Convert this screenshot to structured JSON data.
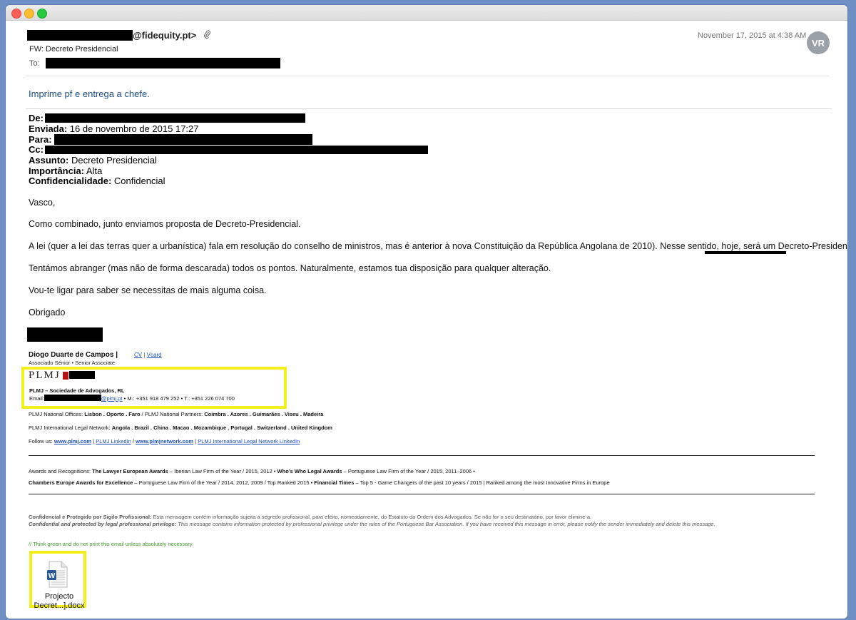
{
  "message": {
    "from_suffix": "@fidequity.pt>",
    "subject": "FW: Decreto Presidencial",
    "to_label": "To:",
    "date": "November 17, 2015 at 4:38 AM",
    "avatar_initials": "VR",
    "forward_note": "Imprime pf e entrega a chefe."
  },
  "original_headers": {
    "de_label": "De:",
    "enviada_label": "Enviada:",
    "enviada_value": " 16 de novembro de 2015 17:27",
    "para_label": "Para:",
    "cc_label": "Cc:",
    "assunto_label": "Assunto:",
    "assunto_value": " Decreto Presidencial",
    "importancia_label": "Importância:",
    "importancia_value": " Alta",
    "confidencialidade_label": "Confidencialidade:",
    "confidencialidade_value": " Confidencial"
  },
  "body": {
    "greeting": "Vasco,",
    "p1": "Como combinado, junto enviamos proposta de Decreto-Presidencial.",
    "p2": "A lei (quer a lei das terras quer a urbanística) fala em resolução do conselho de ministros, mas é anterior à nova Constituição da República Angolana de 2010). Nesse sentido, hoje, será um Decreto-Presidencial.",
    "p3": "Tentámos abranger (mas não de forma descarada) todos os pontos. Naturalmente, estamos tua disposição para qualquer alteração.",
    "p4": "Vou-te ligar para saber se necessitas de mais alguma coisa.",
    "closing": "Obrigado"
  },
  "signature": {
    "name": "Diogo Duarte de Campos |",
    "cv_link": "CV",
    "sep": " | ",
    "vcard_link": "Vcard",
    "role": "Associado Sénior • Senior Associate",
    "logo_text": "PLMJ",
    "firm": "PLMJ – Sociedade de Advogados, RL",
    "email_label": "Email:",
    "email_domain": "@plmj.pt",
    "phones": " • M.: +351 918 479 252 • T.: +351 226 074 700"
  },
  "offices": {
    "national_label": "PLMJ National Offices: ",
    "national": "Lisbon . Oporto . Faro",
    "partners_label": " / PLMJ National Partners: ",
    "partners": "Coimbra . Azores . Guimarães . Viseu . Madeira",
    "intl_label": "PLMJ International Legal Network: ",
    "intl": "Angola . Brazil . China . Macao . Mozambique . Portugal . Switzerland . United Kingdom",
    "follow_label": "Follow us: ",
    "link_site": "www.plmj.com",
    "sep1": " | ",
    "link_linkedin": "PLMJ LinkedIn",
    "sep2": " / ",
    "link_network": "www.plmjnetwork.com",
    "sep3": " | ",
    "link_network_linkedin": " PLMJ International Legal Network LinkedIn"
  },
  "awards": {
    "label": "Awards and Recognitions: ",
    "a1": "The Lawyer European Awards",
    "a1_text": "  – Iberian Law Firm of the Year / 2015, 2012 • ",
    "a2": "Who’s Who Legal Awards",
    "a2_text": " – Portuguese Law Firm of the Year /  2015, 2011–2006 •",
    "a3": "Chambers Europe Awards for Excellence",
    "a3_text": " – Portuguese Law Firm of the Year / 2014, 2012, 2009 / Top Ranked 2015 • ",
    "a4": "Financial Times",
    "a4_text": "  – Top 5 - Game Changers of the past 10 years / 2015 | Ranked among the most Innovative Firms in Europe"
  },
  "disclaimer": {
    "pt_label": "Confidencial e Protegido por Sigilo Profissional:",
    "pt_text": " Esta mensagem contém informação sujeita a segredo profissional, para efeito, nomeadamente, do Estatuto da Ordem dos Advogados. Se não for o seu destinatário, por favor elimine-a.",
    "en_label": "Confidential and protected by legal professional privilege:",
    "en_text": " This message contains information protected by professional privilege under the rules of the Portuguese Bar Association. If you have received this message in error, please notify the sender immediately and delete this message.",
    "green": "// Think green and do not print this email unless absolutely necessary."
  },
  "attachment": {
    "line1": "Projecto",
    "line2": "Decret...].docx",
    "icon": "word-document-icon",
    "icon_letter": "W"
  },
  "colors": {
    "highlight": "#f4ee1a",
    "link": "#1f4fbf",
    "forward_note": "#1c4f8a",
    "green_note": "#3f9a2a"
  }
}
